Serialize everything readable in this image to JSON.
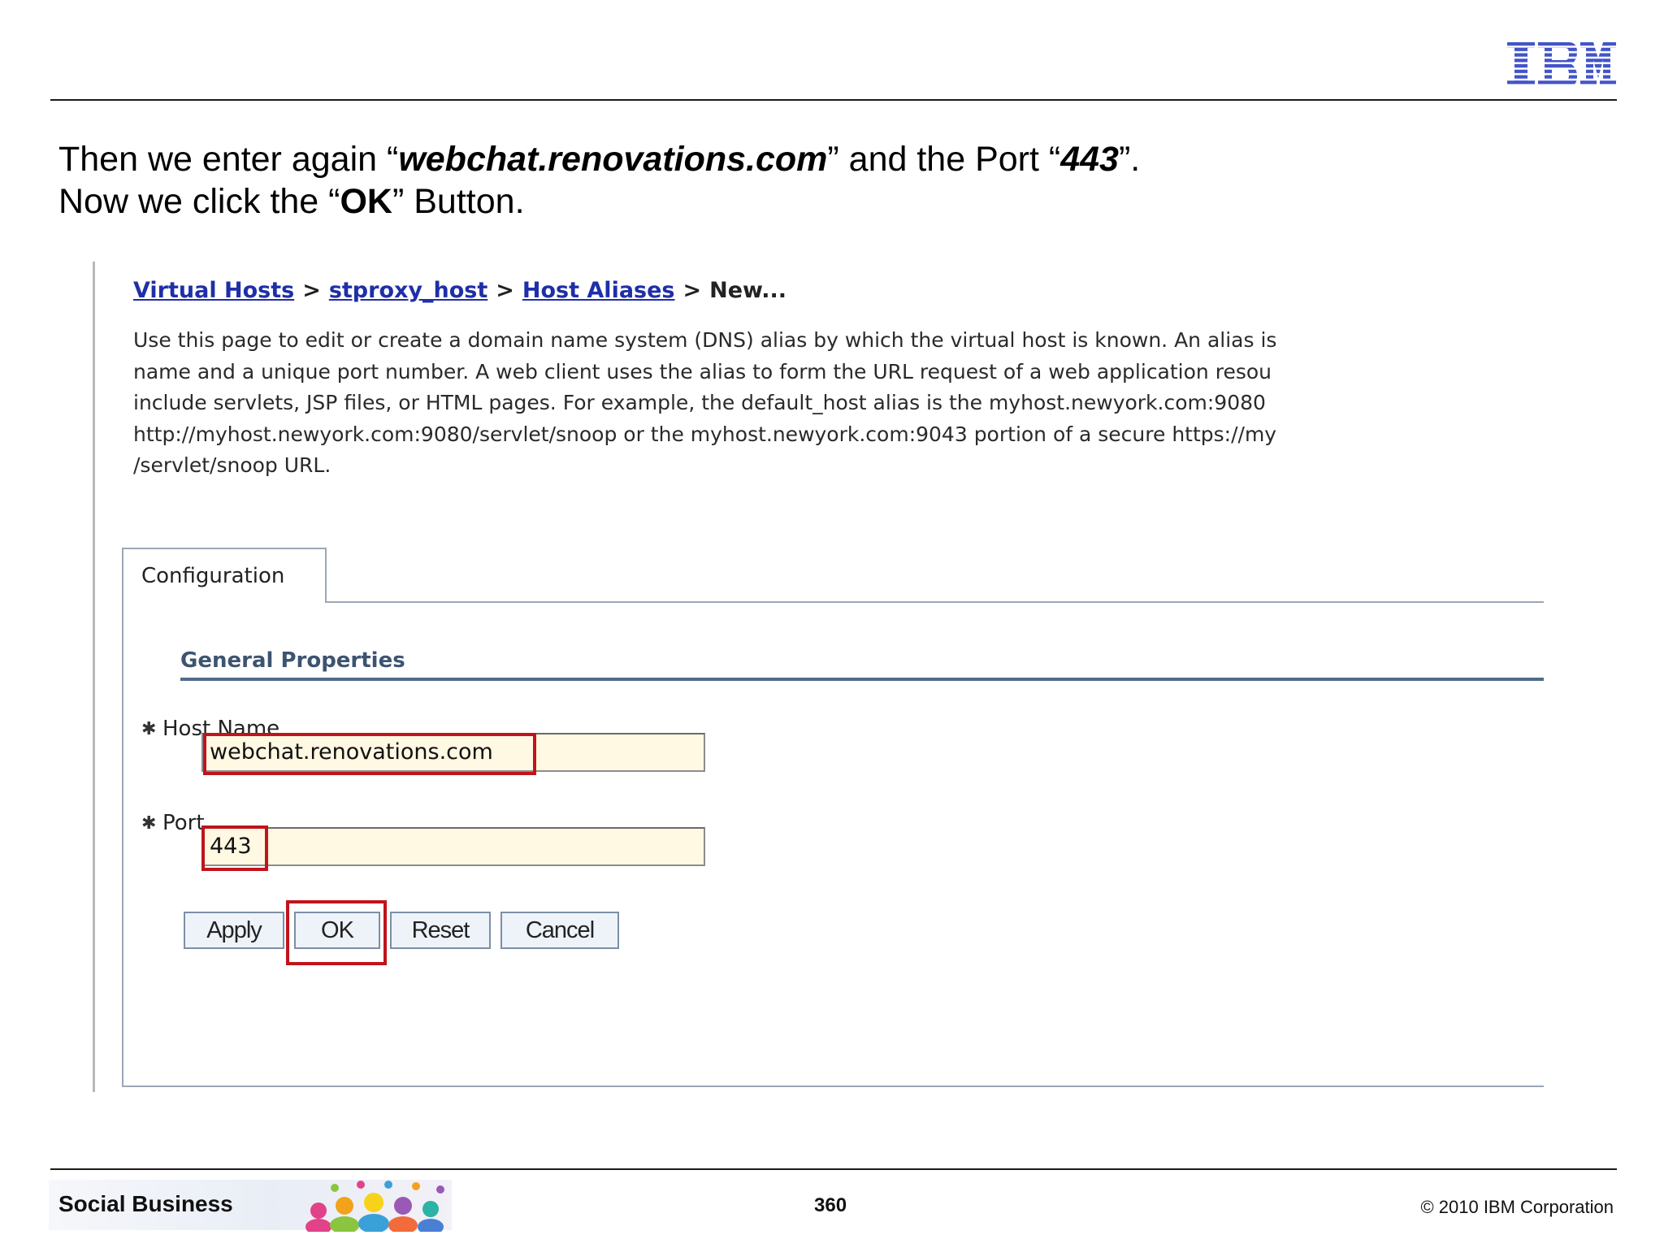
{
  "header": {
    "logo_text": "IBM"
  },
  "instructions": {
    "line1_pre": "Then we enter again “",
    "line1_host": "webchat.renovations.com",
    "line1_mid": "” and the Port “",
    "line1_port": "443",
    "line1_post": "”.",
    "line2_pre": "Now we click the “",
    "line2_ok": "OK",
    "line2_post": "” Button."
  },
  "breadcrumb": {
    "items": [
      "Virtual Hosts",
      "stproxy_host",
      "Host Aliases"
    ],
    "separator": ">",
    "current": "New..."
  },
  "description": {
    "lines": [
      "Use this page to edit or create a domain name system (DNS) alias by which the virtual host is known. An alias is",
      "name and a unique port number. A web client uses the alias to form the URL request of a web application resou",
      "include servlets, JSP files, or HTML pages. For example, the default_host alias is the myhost.newyork.com:9080",
      "http://myhost.newyork.com:9080/servlet/snoop or the myhost.newyork.com:9043 portion of a secure https://my",
      "/servlet/snoop URL."
    ]
  },
  "tabs": [
    {
      "label": "Configuration",
      "active": true
    }
  ],
  "general_properties": {
    "title": "General Properties",
    "required_marker": "✱",
    "host_name": {
      "label": "Host Name",
      "value": "webchat.renovations.com"
    },
    "port": {
      "label": "Port",
      "value": "443"
    }
  },
  "buttons": {
    "apply": "Apply",
    "ok": "OK",
    "reset": "Reset",
    "cancel": "Cancel"
  },
  "highlight_color": "#c0141b",
  "footer": {
    "title": "Social Business",
    "page_number": "360",
    "copyright": "© 2010 IBM Corporation"
  }
}
